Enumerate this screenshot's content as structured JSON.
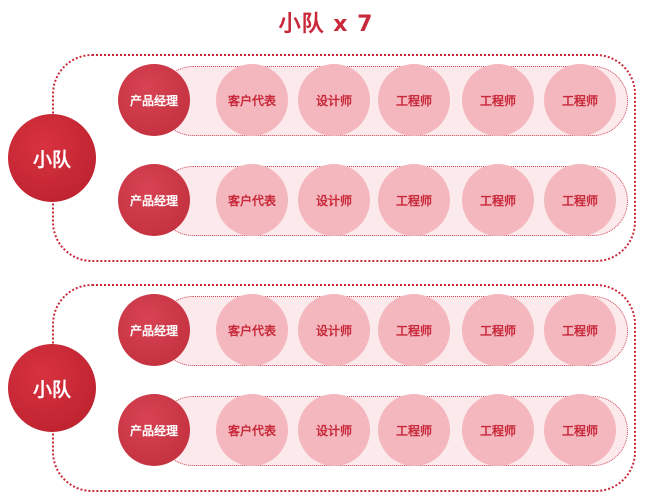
{
  "title": "小队 x 7",
  "team_label": "小队",
  "roles": {
    "lead": "产品经理",
    "members": [
      "客户代表",
      "设计师",
      "工程师",
      "工程师",
      "工程师"
    ]
  },
  "teams_shown": 2,
  "squads_per_team": 2,
  "colors": {
    "primary": "#c8283a",
    "member_fill": "#f3b7bd",
    "band_fill": "#fbe9eb"
  }
}
